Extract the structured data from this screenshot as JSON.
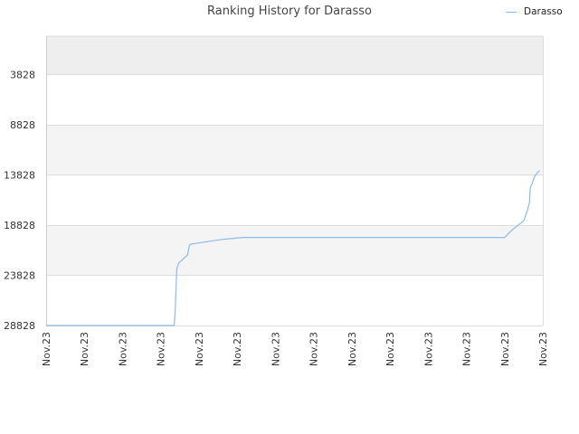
{
  "chart_data": {
    "type": "line",
    "title": "Ranking History for Darasso",
    "xlabel": "",
    "ylabel": "",
    "x_tick_labels": [
      "Nov.23",
      "Nov.23",
      "Nov.23",
      "Nov.23",
      "Nov.23",
      "Nov.23",
      "Nov.23",
      "Nov.23",
      "Nov.23",
      "Nov.23",
      "Nov.23",
      "Nov.23",
      "Nov.23",
      "Nov.23"
    ],
    "y_tick_labels": [
      "3828",
      "8828",
      "13828",
      "18828",
      "23828",
      "28828"
    ],
    "y_ticks": [
      3828,
      8828,
      13828,
      18828,
      23828,
      28828
    ],
    "ylim": [
      28828,
      0
    ],
    "y_inverted": true,
    "grid": true,
    "legend_position": "top-right",
    "series": [
      {
        "name": "Darasso",
        "color": "#88bbee",
        "points": [
          [
            0.0,
            28828
          ],
          [
            3.35,
            28828
          ],
          [
            3.38,
            27300
          ],
          [
            3.42,
            23200
          ],
          [
            3.47,
            22600
          ],
          [
            3.7,
            21800
          ],
          [
            3.75,
            20800
          ],
          [
            3.82,
            20700
          ],
          [
            4.6,
            20250
          ],
          [
            5.15,
            20050
          ],
          [
            8.5,
            20050
          ],
          [
            12.0,
            20050
          ],
          [
            12.2,
            19300
          ],
          [
            12.5,
            18400
          ],
          [
            12.6,
            17300
          ],
          [
            12.65,
            16600
          ],
          [
            12.67,
            15100
          ],
          [
            12.72,
            14700
          ],
          [
            12.78,
            14000
          ],
          [
            12.88,
            13500
          ],
          [
            12.92,
            13400
          ]
        ]
      }
    ],
    "colors": {
      "band_dark": "#eeeeee",
      "band_light": "#f4f4f4",
      "band_white": "#ffffff",
      "grid": "#dddddd",
      "axis": "#cccccc"
    }
  }
}
